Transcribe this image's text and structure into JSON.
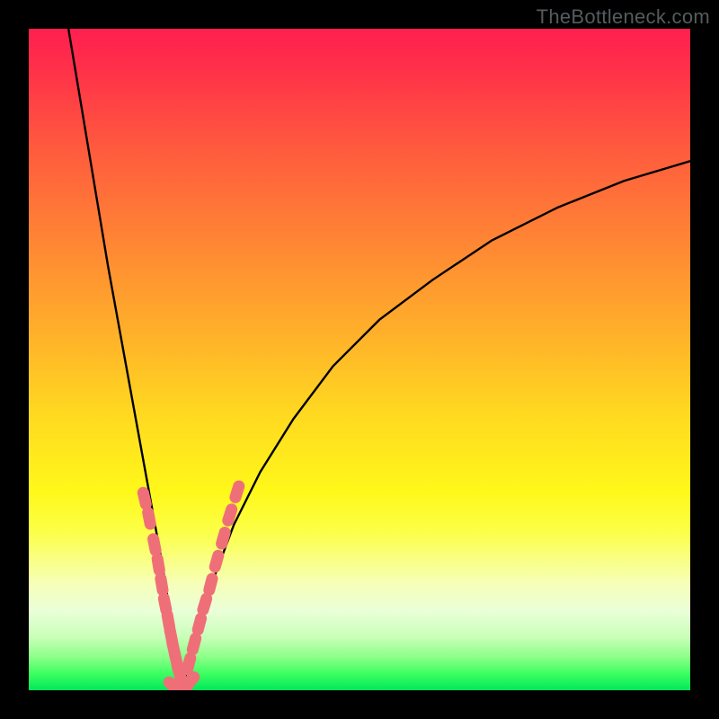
{
  "watermark": "TheBottleneck.com",
  "chart_data": {
    "type": "line",
    "title": "",
    "xlabel": "",
    "ylabel": "",
    "xlim": [
      0,
      100
    ],
    "ylim": [
      0,
      100
    ],
    "grid": false,
    "legend": false,
    "notes": "Unlabeled bottleneck-style V curve over red-to-green vertical gradient. Minimum of the curve occurs near x≈23 at y≈0. Left branch starts near top at x≈6, right branch rises to about y≈80 at x≈100. Pink markers are clustered along both branches near the bottom (roughly y between 2 and 30).",
    "series": [
      {
        "name": "curve",
        "type": "line",
        "color": "#000000",
        "x": [
          6,
          8,
          10,
          12,
          14,
          16,
          18,
          20,
          22,
          23,
          24,
          26,
          28,
          31,
          35,
          40,
          46,
          53,
          61,
          70,
          80,
          90,
          100
        ],
        "y": [
          100,
          88,
          76,
          64,
          53,
          42,
          31,
          20,
          8,
          0,
          3,
          10,
          17,
          25,
          33,
          41,
          49,
          56,
          62,
          68,
          73,
          77,
          80
        ]
      },
      {
        "name": "left-markers",
        "type": "scatter",
        "color": "#ef6f78",
        "x": [
          17.5,
          18.2,
          19.0,
          19.6,
          20.1,
          20.6,
          21.1,
          21.5,
          21.9,
          22.3,
          22.7,
          23.1
        ],
        "y": [
          29,
          26,
          22,
          19,
          16,
          13,
          10.5,
          8.3,
          6.3,
          4.5,
          2.8,
          1.4
        ]
      },
      {
        "name": "right-markers",
        "type": "scatter",
        "color": "#ef6f78",
        "x": [
          24.2,
          25.0,
          25.8,
          26.6,
          27.5,
          28.4,
          29.4,
          30.4,
          31.5
        ],
        "y": [
          4,
          7,
          10,
          13,
          16,
          19.5,
          23,
          26.5,
          30
        ]
      },
      {
        "name": "bottom-fill-markers",
        "type": "scatter",
        "color": "#ef6f78",
        "x": [
          22.0,
          22.6,
          23.2,
          23.8,
          24.4
        ],
        "y": [
          0.8,
          0.5,
          0.4,
          0.6,
          1.3
        ]
      }
    ]
  }
}
